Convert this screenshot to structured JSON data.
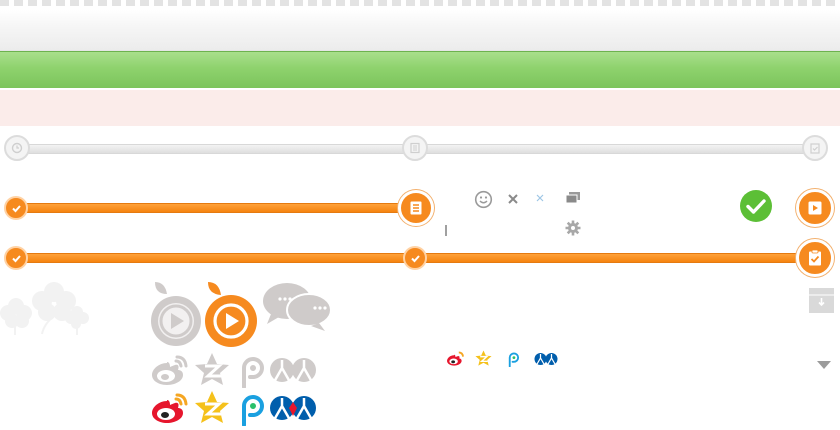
{
  "colors": {
    "orange": "#f68a1f",
    "green_bar": "#8ed26d",
    "pink_bar": "#fbecea",
    "gray_track": "#dedede",
    "success_green": "#5cbf36",
    "weibo_red": "#e6162d",
    "qzone_yellow": "#f5c11b",
    "pengyou_blue": "#1aa0e0",
    "renren_blue": "#005eac",
    "icon_gray": "#c8c4c2"
  },
  "progress_steps": {
    "inactive_row": [
      "clock-icon",
      "list-icon",
      "clipboard-icon"
    ],
    "row_half": {
      "filled_fraction": 0.5,
      "end_icon": "list-icon"
    },
    "row_full": {
      "filled_fraction": 1.0,
      "end_icon": "clipboard-check-icon"
    }
  },
  "icons": [
    "smiley-icon",
    "close-icon",
    "small-close-icon",
    "window-stack-icon",
    "gear-icon",
    "success-check-icon",
    "video-doc-icon",
    "archive-box-icon",
    "dropdown-arrow-icon",
    "flower-decoration-icon",
    "play-button-icon",
    "chat-bubbles-icon",
    "weibo-icon",
    "qzone-icon",
    "pengyou-icon",
    "renren-icon"
  ]
}
